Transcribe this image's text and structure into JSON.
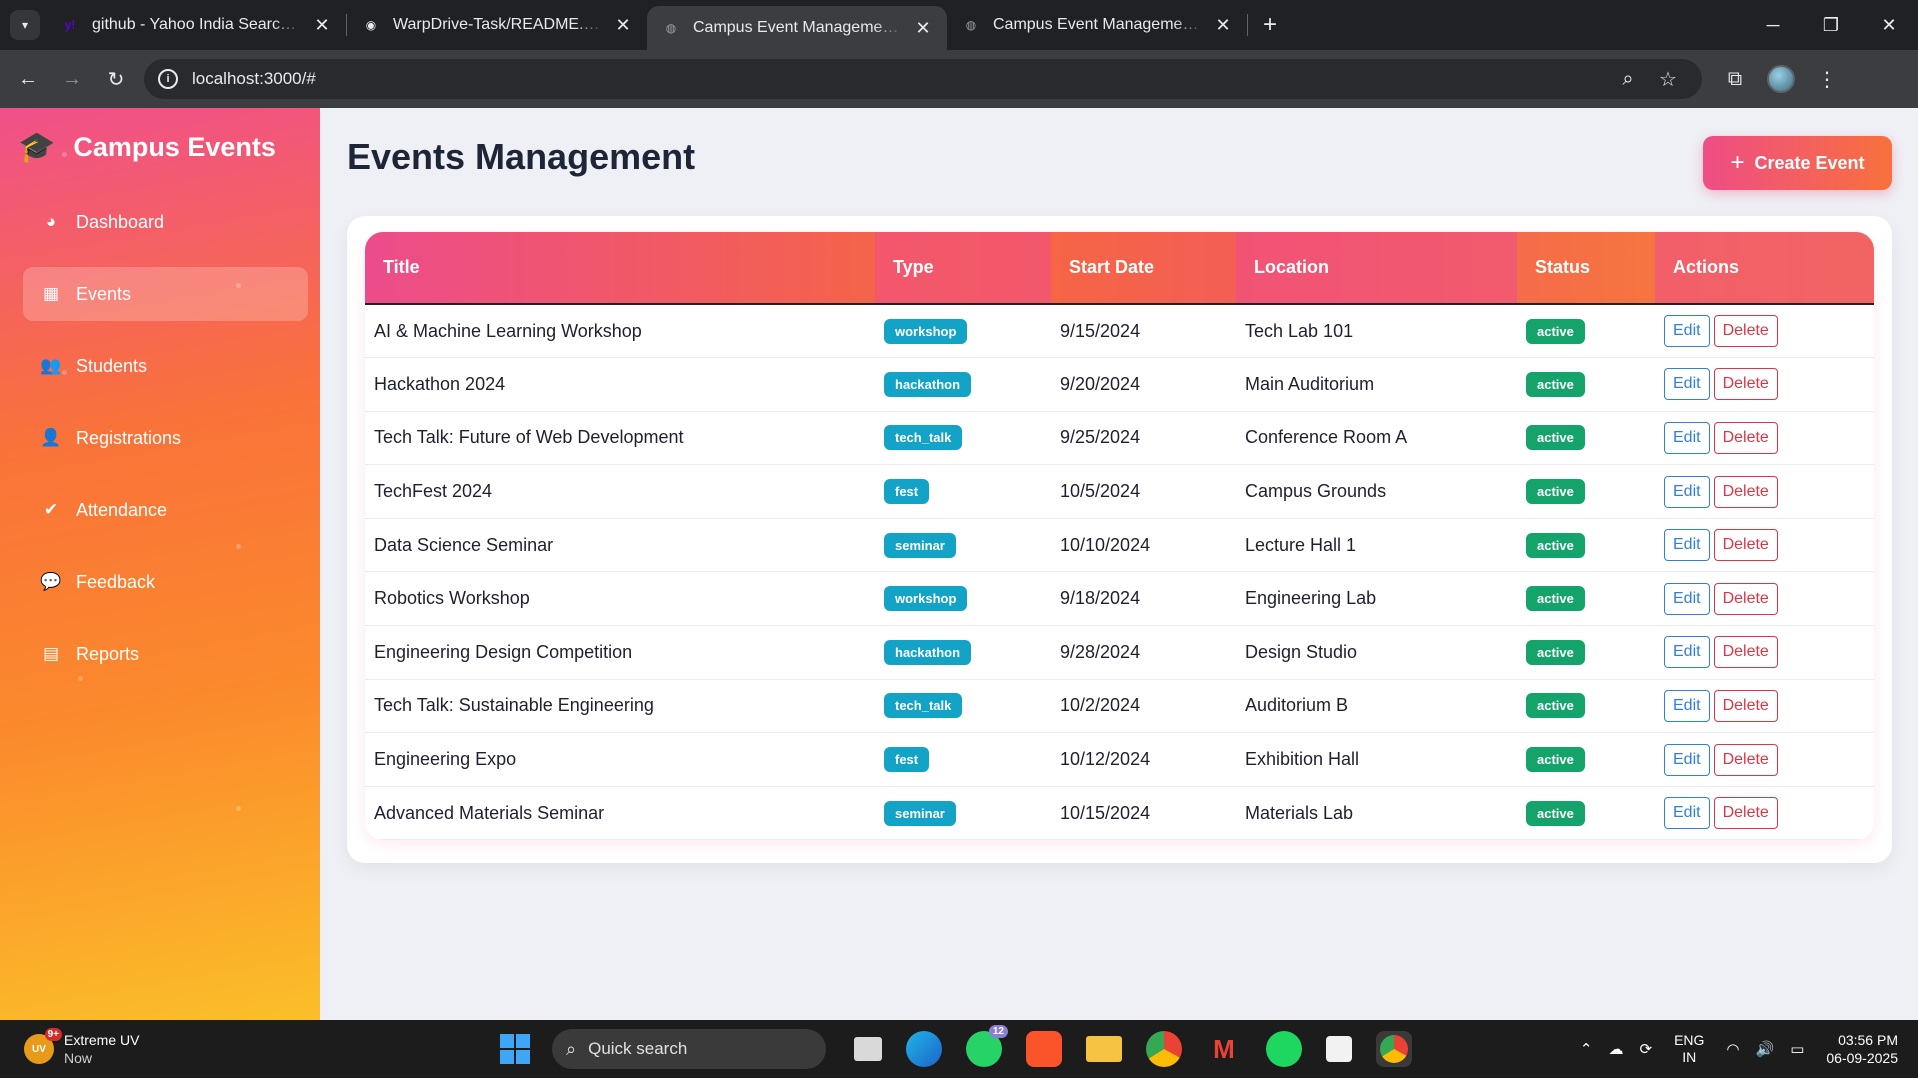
{
  "browser": {
    "tabs": [
      {
        "title": "github - Yahoo India Search Results",
        "favicon": "yahoo-icon",
        "favicon_text": "y!",
        "favicon_color": "#6001d2",
        "active": false
      },
      {
        "title": "WarpDrive-Task/README.md at main",
        "favicon": "github-icon",
        "favicon_text": "◉",
        "favicon_color": "#e8eaed",
        "active": false
      },
      {
        "title": "Campus Event Management Platform",
        "favicon": "globe-icon",
        "favicon_text": "◍",
        "favicon_color": "#9aa0a6",
        "active": true
      },
      {
        "title": "Campus Event Management - S",
        "favicon": "globe-icon",
        "favicon_text": "◍",
        "favicon_color": "#9aa0a6",
        "active": false
      }
    ],
    "url": "localhost:3000/#"
  },
  "sidebar": {
    "brand": "Campus Events",
    "items": [
      {
        "label": "Dashboard",
        "icon": "gauge-icon",
        "glyph": "◕",
        "active": false
      },
      {
        "label": "Events",
        "icon": "calendar-icon",
        "glyph": "▦",
        "active": true
      },
      {
        "label": "Students",
        "icon": "users-icon",
        "glyph": "👥",
        "active": false
      },
      {
        "label": "Registrations",
        "icon": "user-plus-icon",
        "glyph": "👤",
        "active": false
      },
      {
        "label": "Attendance",
        "icon": "check-circle-icon",
        "glyph": "✔",
        "active": false
      },
      {
        "label": "Feedback",
        "icon": "comments-icon",
        "glyph": "💬",
        "active": false
      },
      {
        "label": "Reports",
        "icon": "chart-bar-icon",
        "glyph": "▤",
        "active": false
      }
    ]
  },
  "main": {
    "title": "Events Management",
    "create_button": "Create Event",
    "table": {
      "headers": {
        "title": "Title",
        "type": "Type",
        "start_date": "Start Date",
        "location": "Location",
        "status": "Status",
        "actions": "Actions"
      },
      "edit_label": "Edit",
      "delete_label": "Delete",
      "rows": [
        {
          "title": "AI & Machine Learning Workshop",
          "type": "workshop",
          "start_date": "9/15/2024",
          "location": "Tech Lab 101",
          "status": "active"
        },
        {
          "title": "Hackathon 2024",
          "type": "hackathon",
          "start_date": "9/20/2024",
          "location": "Main Auditorium",
          "status": "active"
        },
        {
          "title": "Tech Talk: Future of Web Development",
          "type": "tech_talk",
          "start_date": "9/25/2024",
          "location": "Conference Room A",
          "status": "active"
        },
        {
          "title": "TechFest 2024",
          "type": "fest",
          "start_date": "10/5/2024",
          "location": "Campus Grounds",
          "status": "active"
        },
        {
          "title": "Data Science Seminar",
          "type": "seminar",
          "start_date": "10/10/2024",
          "location": "Lecture Hall 1",
          "status": "active"
        },
        {
          "title": "Robotics Workshop",
          "type": "workshop",
          "start_date": "9/18/2024",
          "location": "Engineering Lab",
          "status": "active"
        },
        {
          "title": "Engineering Design Competition",
          "type": "hackathon",
          "start_date": "9/28/2024",
          "location": "Design Studio",
          "status": "active"
        },
        {
          "title": "Tech Talk: Sustainable Engineering",
          "type": "tech_talk",
          "start_date": "10/2/2024",
          "location": "Auditorium B",
          "status": "active"
        },
        {
          "title": "Engineering Expo",
          "type": "fest",
          "start_date": "10/12/2024",
          "location": "Exhibition Hall",
          "status": "active"
        },
        {
          "title": "Advanced Materials Seminar",
          "type": "seminar",
          "start_date": "10/15/2024",
          "location": "Materials Lab",
          "status": "active"
        }
      ]
    }
  },
  "taskbar": {
    "weather_title": "Extreme UV",
    "weather_sub": "Now",
    "weather_badge": "9+",
    "weather_icon_text": "UV",
    "search_placeholder": "Quick search",
    "whatsapp_count": "12",
    "lang_top": "ENG",
    "lang_bottom": "IN",
    "time": "03:56 PM",
    "date": "06-09-2025"
  },
  "colors": {
    "accent_pink": "#ee4d86",
    "accent_orange": "#f8713c",
    "type_badge": "#13a3c7",
    "status_badge": "#13a36b",
    "edit": "#2f7fdc",
    "delete": "#dc3545"
  }
}
